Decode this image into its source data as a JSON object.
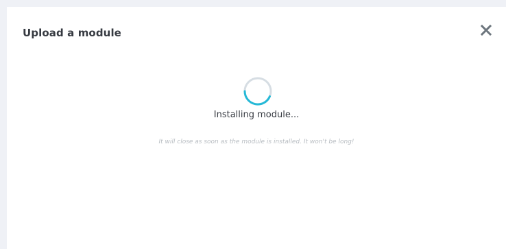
{
  "modal": {
    "title": "Upload a module",
    "close_icon": "close-icon",
    "spinner_icon": "loading-spinner-icon",
    "status": "Installing module...",
    "hint": "It will close as soon as the module is installed. It won't be long!"
  },
  "colors": {
    "backdrop": "#eff1f6",
    "panel": "#ffffff",
    "title_text": "#363a41",
    "hint_text": "#b7bcc1",
    "spinner_track": "#d6dde3",
    "spinner_accent": "#25b9d7"
  }
}
